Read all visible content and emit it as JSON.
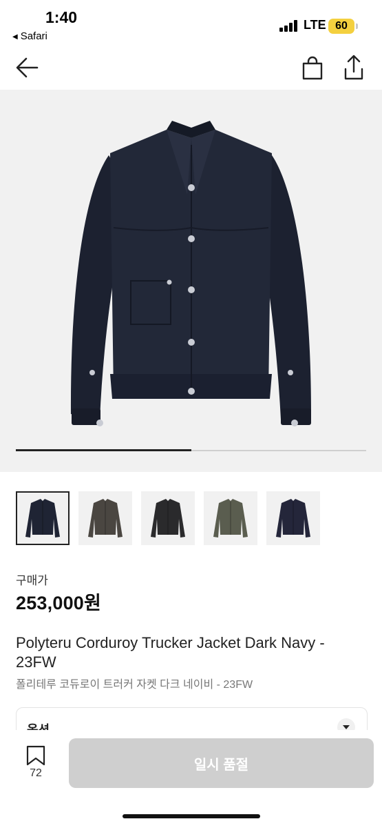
{
  "status_bar": {
    "time": "1:40",
    "back_app": "Safari",
    "network": "LTE",
    "battery": "60",
    "battery_color": "#f4d03f"
  },
  "nav": {
    "back_icon": "arrow-left-icon",
    "bag_icon": "shopping-bag-icon",
    "share_icon": "share-icon"
  },
  "gallery": {
    "progress": 0.5,
    "thumbnails": [
      {
        "color": "#1f2434",
        "selected": true
      },
      {
        "color": "#4a4641",
        "selected": false
      },
      {
        "color": "#2a2a2c",
        "selected": false
      },
      {
        "color": "#5a5d4f",
        "selected": false
      },
      {
        "color": "#24263a",
        "selected": false
      }
    ]
  },
  "product": {
    "price_label": "구매가",
    "price": "253,000원",
    "title_en": "Polyteru Corduroy Trucker Jacket Dark Navy - 23FW",
    "title_ko": "폴리테루 코듀로이 트러커 자켓 다크 네이비 - 23FW"
  },
  "options": {
    "label": "옵션"
  },
  "bottom_bar": {
    "wish_count": "72",
    "sold_out_label": "일시 품절",
    "button_color": "#cfcfcf"
  }
}
